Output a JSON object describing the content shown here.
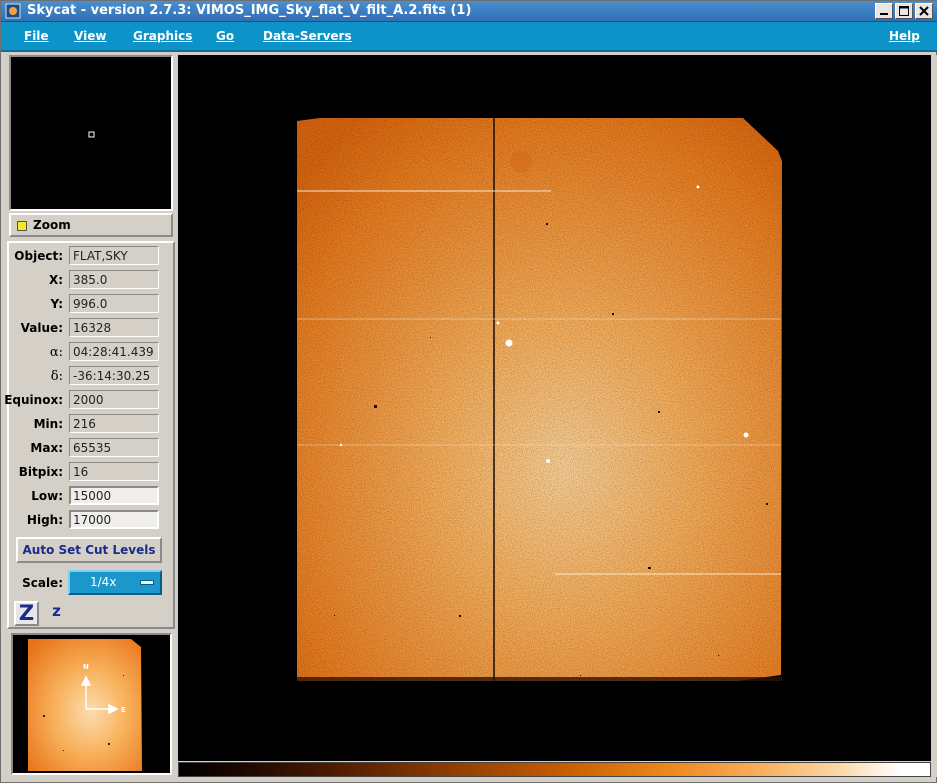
{
  "window": {
    "title": "Skycat - version 2.7.3: VIMOS_IMG_Sky_flat_V_filt_A.2.fits (1)"
  },
  "menubar": {
    "items": [
      "File",
      "View",
      "Graphics",
      "Go",
      "Data-Servers"
    ],
    "help": "Help"
  },
  "zoom": {
    "label": "Zoom"
  },
  "info": {
    "object_label": "Object:",
    "object": "FLAT,SKY",
    "x_label": "X:",
    "x": "385.0",
    "y_label": "Y:",
    "y": "996.0",
    "value_label": "Value:",
    "value": "16328",
    "alpha_label": "α:",
    "alpha": "04:28:41.439",
    "delta_label": "δ:",
    "delta": "-36:14:30.25",
    "equinox_label": "Equinox:",
    "equinox": "2000",
    "min_label": "Min:",
    "min": "216",
    "max_label": "Max:",
    "max": "65535",
    "bitpix_label": "Bitpix:",
    "bitpix": "16",
    "low_label": "Low:",
    "low": "15000",
    "high_label": "High:",
    "high": "17000"
  },
  "controls": {
    "auto_set_cut_levels": "Auto Set Cut Levels",
    "scale_label": "Scale:",
    "scale_value": "1/4x",
    "zoom_in_label": "Z",
    "zoom_out_label": "z"
  },
  "compass": {
    "north": "N",
    "east": "E"
  },
  "colors": {
    "menubar": "#0e93c9",
    "image_orange": "#f28a24",
    "accent_blue": "#1a2b8a"
  }
}
